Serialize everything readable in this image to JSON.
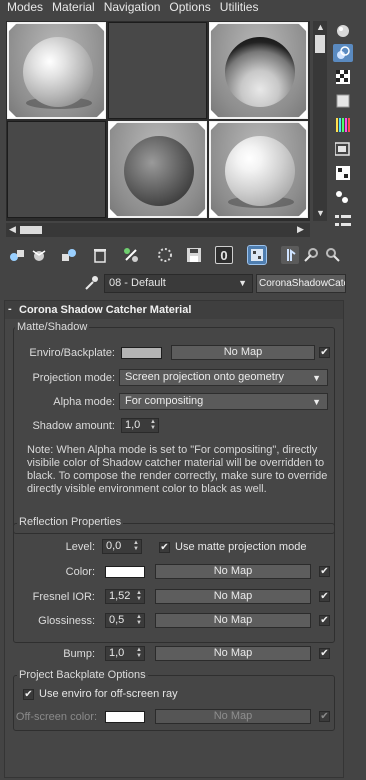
{
  "menu": [
    "Modes",
    "Material",
    "Navigation",
    "Options",
    "Utilities"
  ],
  "slots": [
    {
      "kind": "rendered",
      "sphere": "matte",
      "selected": true
    },
    {
      "kind": "empty"
    },
    {
      "kind": "rendered",
      "sphere": "glass",
      "selected": true
    },
    {
      "kind": "empty"
    },
    {
      "kind": "rendered",
      "sphere": "dark",
      "selected": true
    },
    {
      "kind": "rendered",
      "sphere": "glossy",
      "selected": true
    }
  ],
  "right_icons": [
    "sample-type-sphere-icon",
    "backlight-icon",
    "checker-background-icon",
    "uv-tiling-icon",
    "video-color-check-icon",
    "make-preview-icon",
    "options-icon",
    "select-by-material-icon",
    "material-map-navigator-icon"
  ],
  "toolbar_icons": [
    "get-material-icon",
    "put-to-scene-icon",
    "assign-to-selection-icon",
    "reset-map-icon",
    "make-unique-icon",
    "put-to-library-icon",
    "material-id-channel-icon",
    "show-shaded-in-viewport-icon",
    "show-end-result-icon",
    "go-to-parent-icon",
    "go-forward-to-sibling-icon"
  ],
  "material_id_value": "0",
  "material": {
    "name": "08 - Default",
    "type": "CoronaShadowCatcher"
  },
  "rollout": {
    "title": "Corona Shadow Catcher Material",
    "collapse_symbol": "-"
  },
  "matte": {
    "title": "Matte/Shadow",
    "enviro_label": "Enviro/Backplate:",
    "enviro_color": "#b4b4b4",
    "enviro_map": "No Map",
    "enviro_checked": true,
    "projection_label": "Projection mode:",
    "projection_value": "Screen projection onto geometry",
    "alpha_label": "Alpha mode:",
    "alpha_value": "For compositing",
    "shadow_label": "Shadow amount:",
    "shadow_value": "1,0",
    "note_lines": [
      "Note: When Alpha mode is set to \"For compositing\", directly",
      "visibile color of Shadow catcher material will be overridden to",
      "black. To compose the render correctly, make sure to override",
      "directly visible environment color to black as well."
    ]
  },
  "reflection": {
    "title": "Reflection Properties",
    "level_label": "Level:",
    "level_value": "0,0",
    "use_matte_label": "Use matte projection mode",
    "use_matte_checked": true,
    "color_label": "Color:",
    "color_value": "#ffffff",
    "color_map": "No Map",
    "color_checked": true,
    "fresnel_label": "Fresnel IOR:",
    "fresnel_value": "1,52",
    "fresnel_map": "No Map",
    "fresnel_checked": true,
    "gloss_label": "Glossiness:",
    "gloss_value": "0,5",
    "gloss_map": "No Map",
    "gloss_checked": true
  },
  "bump": {
    "label": "Bump:",
    "value": "1,0",
    "map": "No Map",
    "checked": true
  },
  "backplate": {
    "title": "Project Backplate Options",
    "use_enviro_label": "Use enviro for off-screen ray",
    "use_enviro_checked": true,
    "offscreen_label": "Off-screen color:",
    "offscreen_color": "#ffffff",
    "offscreen_map": "No Map",
    "offscreen_checked": true
  },
  "check_glyph": "✔"
}
